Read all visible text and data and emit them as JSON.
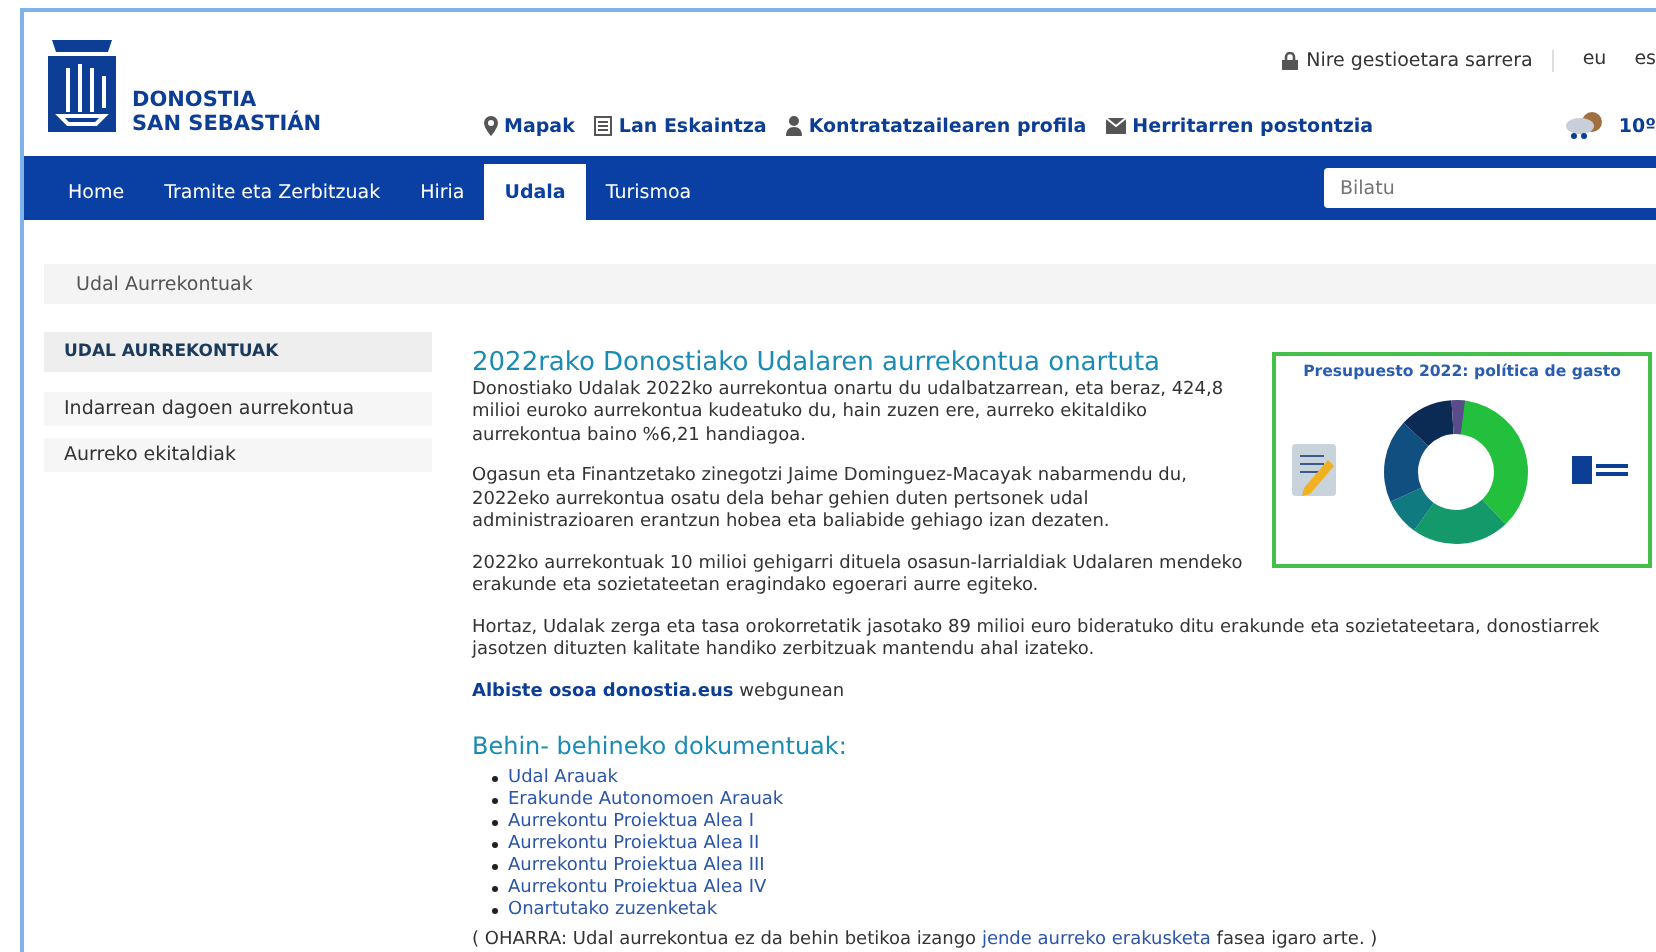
{
  "header": {
    "logo_lines": [
      "DONOSTIA",
      "SAN SEBASTIÁN"
    ],
    "login_link": "Nire gestioetara sarrera",
    "languages": [
      "eu",
      "es"
    ],
    "quick_links": [
      {
        "kind": "pin",
        "label": "Mapak"
      },
      {
        "kind": "list",
        "label": "Lan Eskaintza"
      },
      {
        "kind": "person",
        "label": "Kontratatzailearen profila"
      },
      {
        "kind": "mail",
        "label": "Herritarren postontzia"
      }
    ],
    "weather": "10º"
  },
  "nav": {
    "items": [
      {
        "label": "Home",
        "selected": false
      },
      {
        "label": "Tramite eta Zerbitzuak",
        "selected": false
      },
      {
        "label": "Hiria",
        "selected": false
      },
      {
        "label": "Udala",
        "selected": true
      },
      {
        "label": "Turismoa",
        "selected": false
      }
    ],
    "search_placeholder": "Bilatu"
  },
  "breadcrumb": "Udal Aurrekontuak",
  "sidebar": {
    "heading": "UDAL AURREKONTUAK",
    "items": [
      "Indarrean dagoen aurrekontua",
      "Aurreko ekitaldiak"
    ]
  },
  "article": {
    "title": "2022rako Donostiako Udalaren aurrekontua onartuta",
    "infographic_title": "Presupuesto 2022: política de gasto",
    "paragraphs": [
      "Donostiako Udalak 2022ko aurrekontua onartu du udalbatzarrean, eta beraz, 424,8 milioi euroko aurrekontua kudeatuko du, hain zuzen ere, aurreko ekitaldiko aurrekontua baino %6,21 handiagoa.",
      "Ogasun eta Finantzetako zinegotzi Jaime Dominguez-Macayak nabarmendu du, 2022eko aurrekontua osatu dela behar gehien duten pertsonek udal administrazioaren erantzun hobea eta baliabide gehiago izan dezaten.",
      "2022ko aurrekontuak 10 milioi gehigarri dituela osasun-larrialdiak Udalaren mendeko erakunde eta sozietateetan eragindako egoerari aurre egiteko.",
      "Hortaz, Udalak zerga eta tasa orokorretatik jasotako 89 milioi euro bideratuko ditu erakunde eta sozietateetara, donostiarrek jasotzen dituzten kalitate handiko zerbitzuak mantendu ahal izateko."
    ],
    "more_link": "Albiste osoa donostia.eus",
    "more_suffix": "webgunean",
    "docs_heading": "Behin- behineko dokumentuak:",
    "docs": [
      "Udal Arauak",
      "Erakunde Autonomoen Arauak",
      "Aurrekontu Proiektua Alea I",
      "Aurrekontu Proiektua Alea II",
      "Aurrekontu Proiektua Alea III",
      "Aurrekontu Proiektua Alea IV",
      "Onartutako zuzenketak"
    ],
    "note_before": "( OHARRA: Udal aurrekontua ez da behin betikoa izango",
    "note_link": "jende aurreko erakusketa",
    "note_after": "fasea igaro arte. )"
  }
}
